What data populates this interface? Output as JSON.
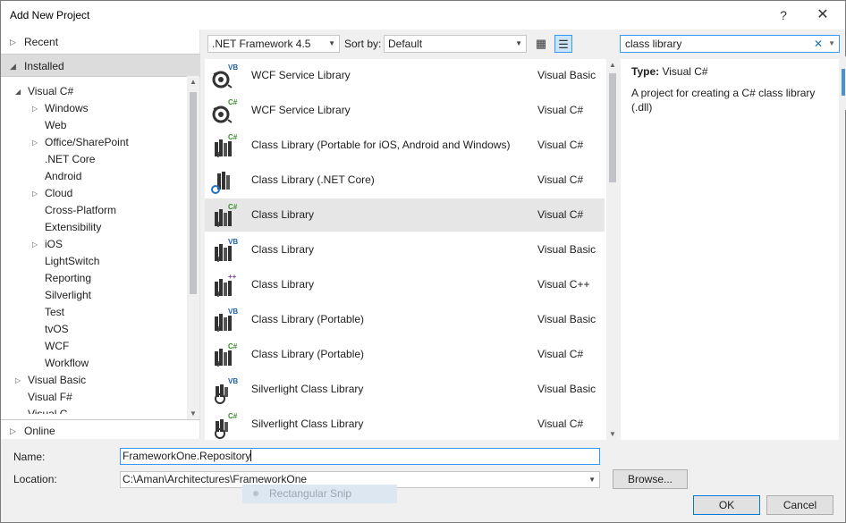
{
  "window": {
    "title": "Add New Project",
    "help_label": "?",
    "close_label": "✕"
  },
  "left_panel": {
    "recent": "Recent",
    "installed": "Installed",
    "online": "Online",
    "tree": [
      {
        "label": "Visual C#",
        "expanded": true
      },
      {
        "label": "Windows",
        "arrow": true
      },
      {
        "label": "Web"
      },
      {
        "label": "Office/SharePoint",
        "arrow": true
      },
      {
        "label": ".NET Core"
      },
      {
        "label": "Android"
      },
      {
        "label": "Cloud",
        "arrow": true
      },
      {
        "label": "Cross-Platform"
      },
      {
        "label": "Extensibility"
      },
      {
        "label": "iOS",
        "arrow": true
      },
      {
        "label": "LightSwitch"
      },
      {
        "label": "Reporting"
      },
      {
        "label": "Silverlight"
      },
      {
        "label": "Test"
      },
      {
        "label": "tvOS"
      },
      {
        "label": "WCF"
      },
      {
        "label": "Workflow"
      },
      {
        "label": "Visual Basic",
        "arrow": true
      },
      {
        "label": "Visual F#"
      },
      {
        "label": "Visual C..."
      }
    ]
  },
  "toolbar": {
    "framework": ".NET Framework 4.5",
    "sort_label": "Sort by:",
    "sort_value": "Default",
    "search_value": "class library",
    "search_clear": "✕"
  },
  "templates": [
    {
      "name": "WCF Service Library",
      "lang": "Visual Basic",
      "badge": "VB",
      "badge_color": "#1e5faa",
      "icon": "wcf"
    },
    {
      "name": "WCF Service Library",
      "lang": "Visual C#",
      "badge": "C#",
      "badge_color": "#3a8a2c",
      "icon": "wcf"
    },
    {
      "name": "Class Library (Portable for iOS, Android and Windows)",
      "lang": "Visual C#",
      "badge": "C#",
      "badge_color": "#3a8a2c",
      "icon": "lib"
    },
    {
      "name": "Class Library (.NET Core)",
      "lang": "Visual C#",
      "badge": "",
      "badge_color": "#1e72c2",
      "icon": "core"
    },
    {
      "name": "Class Library",
      "lang": "Visual C#",
      "badge": "C#",
      "badge_color": "#3a8a2c",
      "icon": "lib",
      "selected": true
    },
    {
      "name": "Class Library",
      "lang": "Visual Basic",
      "badge": "VB",
      "badge_color": "#1e5faa",
      "icon": "lib"
    },
    {
      "name": "Class Library",
      "lang": "Visual C++",
      "badge": "++",
      "badge_color": "#7a3fa0",
      "icon": "lib"
    },
    {
      "name": "Class Library (Portable)",
      "lang": "Visual Basic",
      "badge": "VB",
      "badge_color": "#1e5faa",
      "icon": "lib"
    },
    {
      "name": "Class Library (Portable)",
      "lang": "Visual C#",
      "badge": "C#",
      "badge_color": "#3a8a2c",
      "icon": "lib"
    },
    {
      "name": "Silverlight Class Library",
      "lang": "Visual Basic",
      "badge": "VB",
      "badge_color": "#1e5faa",
      "icon": "silver"
    },
    {
      "name": "Silverlight Class Library",
      "lang": "Visual C#",
      "badge": "C#",
      "badge_color": "#3a8a2c",
      "icon": "silver"
    }
  ],
  "details": {
    "type_label": "Type:",
    "type_value": "Visual C#",
    "description": "A project for creating a C# class library (.dll)"
  },
  "form": {
    "name_label": "Name:",
    "name_value": "FrameworkOne.Repository",
    "location_label": "Location:",
    "location_value": "C:\\Aman\\Architectures\\FrameworkOne",
    "browse": "Browse...",
    "ok": "OK",
    "cancel": "Cancel",
    "snip_label": "Rectangular Snip"
  }
}
